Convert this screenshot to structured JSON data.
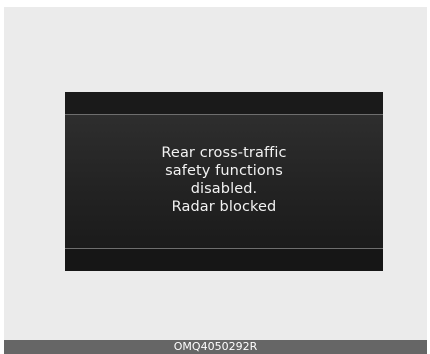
{
  "display": {
    "message_lines": [
      "Rear cross-traffic",
      "safety functions",
      "disabled.",
      "Radar blocked"
    ]
  },
  "caption": {
    "code": "OMQ4050292R"
  },
  "colors": {
    "frame_background": "#ebebeb",
    "display_background": "#1f1f1f",
    "message_text": "#f2f2f2",
    "caption_bar": "#666666"
  }
}
